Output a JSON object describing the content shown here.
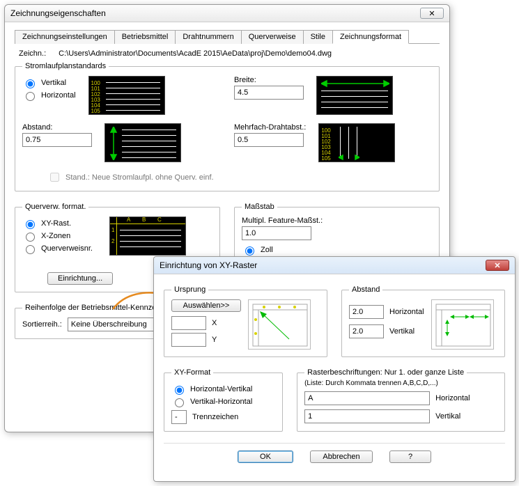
{
  "main": {
    "title": "Zeichnungseigenschaften",
    "tabs": [
      "Zeichnungseinstellungen",
      "Betriebsmittel",
      "Drahtnummern",
      "Querverweise",
      "Stile",
      "Zeichnungsformat"
    ],
    "zeichn_label": "Zeichn.:",
    "zeichn_path": "C:\\Users\\Administrator\\Documents\\AcadE 2015\\AeData\\proj\\Demo\\demo04.dwg",
    "standards": {
      "legend": "Stromlaufplanstandards",
      "vertikal": "Vertikal",
      "horizontal": "Horizontal",
      "abstand_label": "Abstand:",
      "abstand_value": "0.75",
      "breite_label": "Breite:",
      "breite_value": "4.5",
      "mehrfach_label": "Mehrfach-Drahtabst.:",
      "mehrfach_value": "0.5",
      "stand_chk": "Stand.: Neue Stromlaufpl. ohne Querv. einf."
    },
    "querverw": {
      "legend": "Querverw. format.",
      "xy": "XY-Rast.",
      "xz": "X-Zonen",
      "qvnr": "Querverweisnr.",
      "einricht": "Einrichtung..."
    },
    "massstab": {
      "legend": "Maßstab",
      "multipl_label": "Multipl. Feature-Maßst.:",
      "multipl_value": "1.0",
      "zoll": "Zoll"
    },
    "reihen_label": "Reihenfolge der Betriebsmittel-Kennze",
    "sortier_label": "Sortierreih.:",
    "sortier_value": "Keine Überschreibung"
  },
  "sub": {
    "title": "Einrichtung von XY-Raster",
    "ursprung": {
      "legend": "Ursprung",
      "ausw_btn": "Auswählen>>",
      "x_label": "X",
      "y_label": "Y"
    },
    "abstand": {
      "legend": "Abstand",
      "horiz_val": "2.0",
      "horiz_label": "Horizontal",
      "vert_val": "2.0",
      "vert_label": "Vertikal"
    },
    "xyformat": {
      "legend": "XY-Format",
      "hv": "Horizontal-Vertikal",
      "vh": "Vertikal-Horizontal",
      "trenn_label": "Trennzeichen",
      "trenn_val": "-"
    },
    "raster": {
      "legend": "Rasterbeschriftungen: Nur 1. oder ganze Liste",
      "sub": "(Liste: Durch Kommata trennen A,B,C,D,...)",
      "horiz_val": "A",
      "horiz_label": "Horizontal",
      "vert_val": "1",
      "vert_label": "Vertikal"
    },
    "btns": {
      "ok": "OK",
      "cancel": "Abbrechen",
      "help": "?"
    }
  }
}
